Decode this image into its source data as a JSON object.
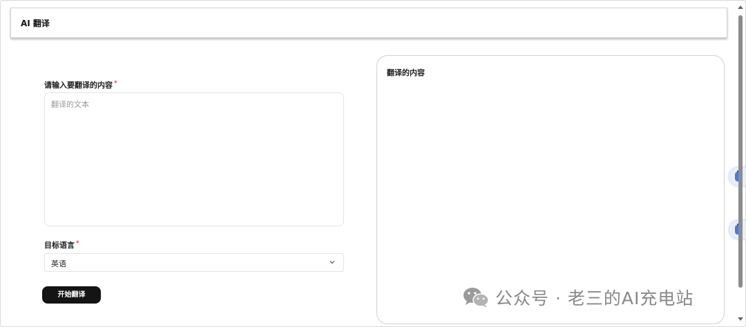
{
  "header": {
    "title": "AI 翻译"
  },
  "form": {
    "source_label": "请输入要翻译的内容",
    "required_mark": "*",
    "source_placeholder": "翻译的文本",
    "source_value": "",
    "target_label": "目标语言",
    "target_value": "英语",
    "submit_label": "开始翻译"
  },
  "result": {
    "title": "翻译的内容",
    "content": ""
  },
  "watermark": {
    "text": "公众号 · 老三的AI充电站"
  },
  "icons": {
    "chevron": "chevron-down-icon",
    "float": "assistant-icon",
    "logo": "wechat-logo-icon"
  }
}
